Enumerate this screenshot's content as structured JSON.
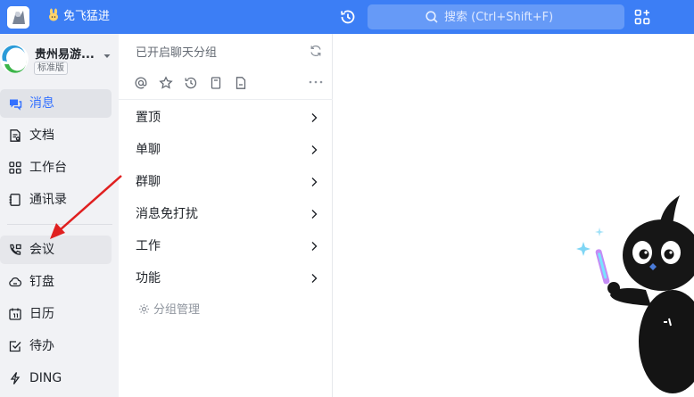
{
  "topbar": {
    "org_name": "免飞猛进",
    "search_placeholder": "搜索 (Ctrl+Shift+F)"
  },
  "org": {
    "name": "贵州易游...",
    "badge": "标准版"
  },
  "nav": {
    "items": [
      {
        "label": "消息",
        "icon": "message-icon"
      },
      {
        "label": "文档",
        "icon": "document-icon"
      },
      {
        "label": "工作台",
        "icon": "workbench-icon"
      },
      {
        "label": "通讯录",
        "icon": "contacts-icon"
      },
      {
        "label": "会议",
        "icon": "meeting-icon"
      },
      {
        "label": "钉盘",
        "icon": "cloud-drive-icon"
      },
      {
        "label": "日历",
        "icon": "calendar-icon"
      },
      {
        "label": "待办",
        "icon": "todo-icon"
      },
      {
        "label": "DING",
        "icon": "ding-icon"
      }
    ]
  },
  "chat_groups": {
    "header": "已开启聊天分组",
    "groups": [
      "置顶",
      "单聊",
      "群聊",
      "消息免打扰",
      "工作",
      "功能"
    ],
    "manage_label": "分组管理"
  },
  "colors": {
    "accent": "#3c7ef5",
    "active_text": "#3370ff",
    "annotation_arrow": "#e02020"
  }
}
